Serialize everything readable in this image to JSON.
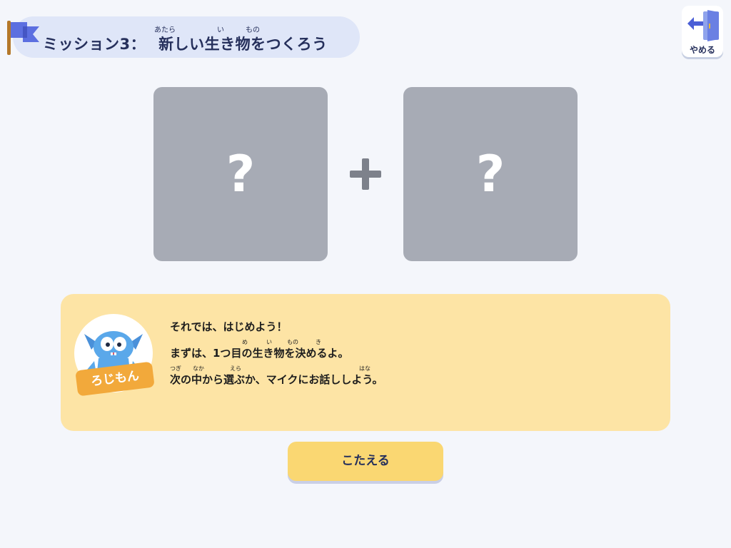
{
  "header": {
    "mission_title_prefix": "ミッション3：",
    "mission_title_main": "新しい生き物をつくろう",
    "ruby_atara": "あたら",
    "ruby_i": "い",
    "ruby_mono": "もの"
  },
  "quit": {
    "label": "やめる"
  },
  "slots": {
    "left_symbol": "?",
    "right_symbol": "?"
  },
  "colors": {
    "background": "#f4f6fb",
    "header_bg": "#dfe6f8",
    "slot_gray": "#a7abb5",
    "dialogue_bg": "#fde4a5",
    "name_tag": "#f2a93b",
    "answer_button": "#fad772",
    "flag_blue": "#5c6fe0"
  },
  "icons": {
    "flag": "flag-icon",
    "quit": "exit-door-icon",
    "plus": "plus-icon",
    "character": "rojimon-character-icon"
  },
  "dialogue": {
    "speaker_name": "ろじもん",
    "line1": "それでは、はじめよう！",
    "line2": "まずは、1つ目の生き物を決めるよ。",
    "line3": "次の中から選ぶか、マイクにお話ししよう。",
    "ruby_me": "め",
    "ruby_i": "い",
    "ruby_mono": "もの",
    "ruby_ki": "き",
    "ruby_tsugi": "つぎ",
    "ruby_naka": "なか",
    "ruby_era": "えら",
    "ruby_hana": "はな"
  },
  "answer": {
    "label": "こたえる"
  }
}
